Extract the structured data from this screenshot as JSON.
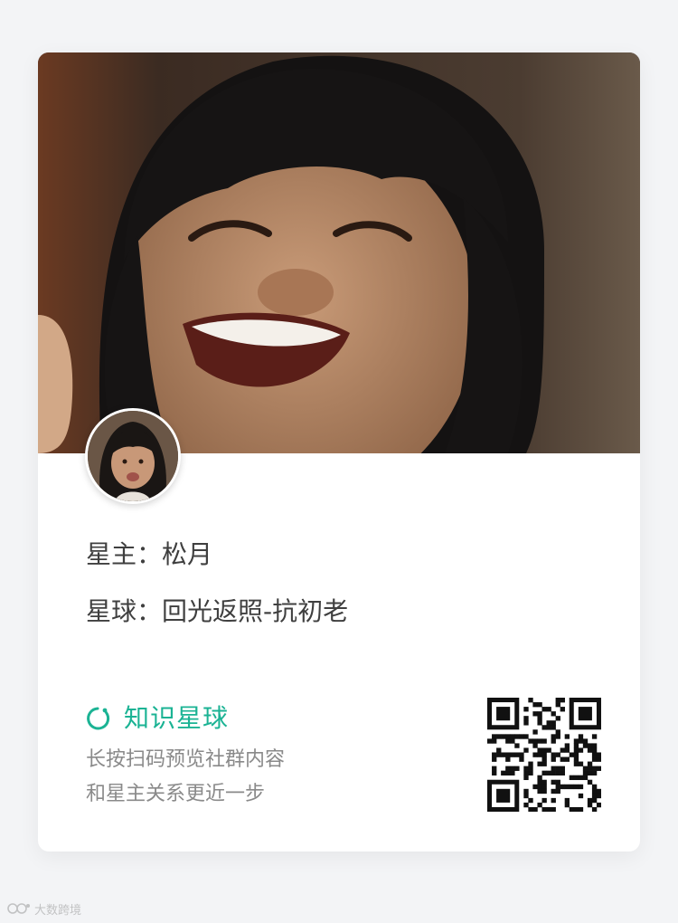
{
  "owner": {
    "label": "星主：",
    "name": "松月"
  },
  "planet": {
    "label": "星球：",
    "name": "回光返照-抗初老"
  },
  "brand": {
    "name": "知识星球",
    "logo_icon": "zsxq-logo-icon",
    "color": "#1bb394"
  },
  "description": {
    "line1": "长按扫码预览社群内容",
    "line2": "和星主关系更近一步"
  },
  "qrcode": {
    "icon": "qr-code"
  },
  "watermark": {
    "text": "大数跨境"
  }
}
